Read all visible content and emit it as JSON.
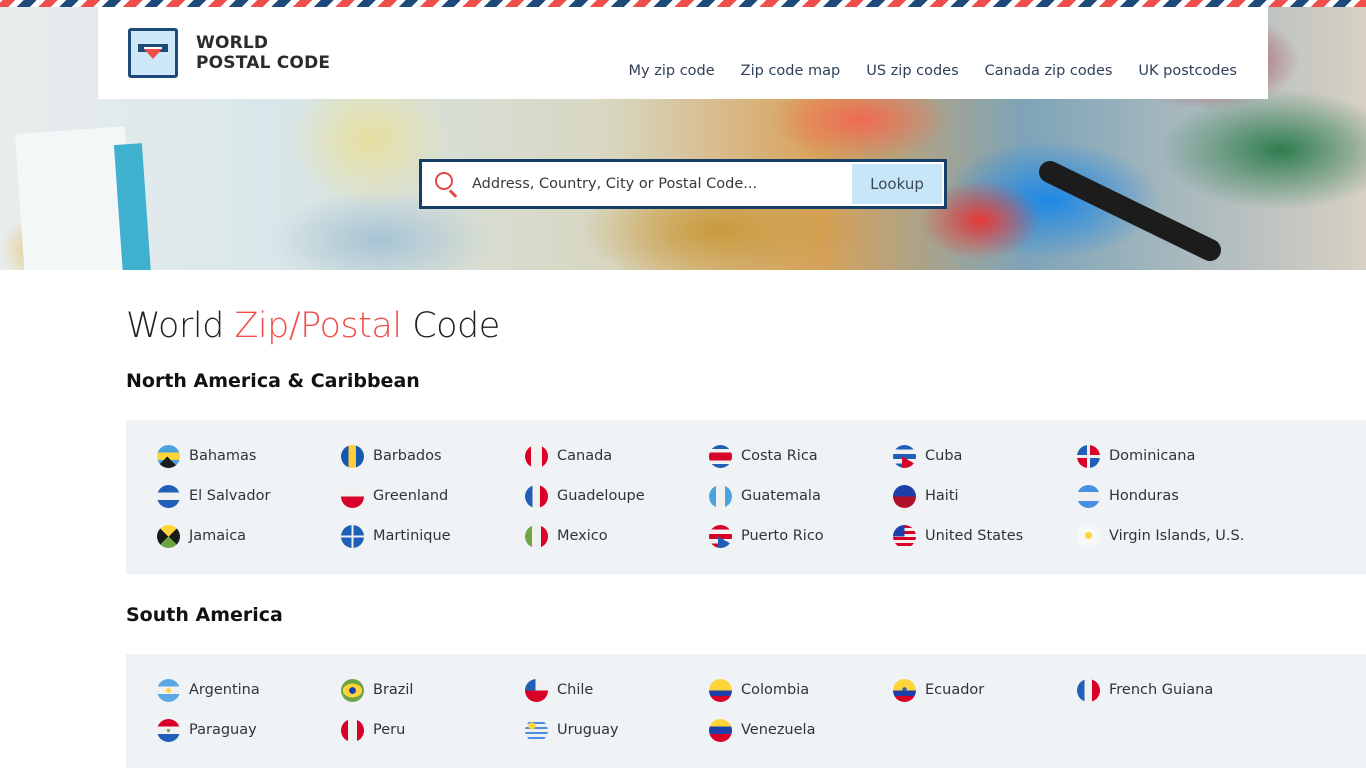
{
  "brand": {
    "line1": "WORLD",
    "line2": "POSTAL CODE"
  },
  "nav": [
    {
      "label": "My zip code"
    },
    {
      "label": "Zip code map"
    },
    {
      "label": "US zip codes"
    },
    {
      "label": "Canada zip codes"
    },
    {
      "label": "UK postcodes"
    }
  ],
  "search": {
    "placeholder": "Address, Country, City or Postal Code...",
    "value": "",
    "button_label": "Lookup",
    "icon": "search-icon"
  },
  "page_title": {
    "pre": "World ",
    "accent": "Zip/Postal",
    "post": " Code"
  },
  "colors": {
    "accent": "#f04e4a",
    "brand_blue": "#1d4a7a",
    "panel_bg": "#eff3f6",
    "button_bg": "#c7e6f7"
  },
  "regions": [
    {
      "name": "North America & Caribbean",
      "countries": [
        {
          "name": "Bahamas",
          "flag": "bahamas"
        },
        {
          "name": "Barbados",
          "flag": "barbados"
        },
        {
          "name": "Canada",
          "flag": "canada"
        },
        {
          "name": "Costa Rica",
          "flag": "costa-rica"
        },
        {
          "name": "Cuba",
          "flag": "cuba"
        },
        {
          "name": "Dominicana",
          "flag": "dominicana"
        },
        {
          "name": "El Salvador",
          "flag": "el-salvador"
        },
        {
          "name": "Greenland",
          "flag": "greenland"
        },
        {
          "name": "Guadeloupe",
          "flag": "guadeloupe"
        },
        {
          "name": "Guatemala",
          "flag": "guatemala"
        },
        {
          "name": "Haiti",
          "flag": "haiti"
        },
        {
          "name": "Honduras",
          "flag": "honduras"
        },
        {
          "name": "Jamaica",
          "flag": "jamaica"
        },
        {
          "name": "Martinique",
          "flag": "martinique"
        },
        {
          "name": "Mexico",
          "flag": "mexico"
        },
        {
          "name": "Puerto Rico",
          "flag": "puerto-rico"
        },
        {
          "name": "United States",
          "flag": "united-states"
        },
        {
          "name": "Virgin Islands, U.S.",
          "flag": "virgin-islands-us"
        }
      ]
    },
    {
      "name": "South America",
      "countries": [
        {
          "name": "Argentina",
          "flag": "argentina"
        },
        {
          "name": "Brazil",
          "flag": "brazil"
        },
        {
          "name": "Chile",
          "flag": "chile"
        },
        {
          "name": "Colombia",
          "flag": "colombia"
        },
        {
          "name": "Ecuador",
          "flag": "ecuador"
        },
        {
          "name": "French Guiana",
          "flag": "french-guiana"
        },
        {
          "name": "Paraguay",
          "flag": "paraguay"
        },
        {
          "name": "Peru",
          "flag": "peru"
        },
        {
          "name": "Uruguay",
          "flag": "uruguay"
        },
        {
          "name": "Venezuela",
          "flag": "venezuela"
        }
      ]
    }
  ]
}
